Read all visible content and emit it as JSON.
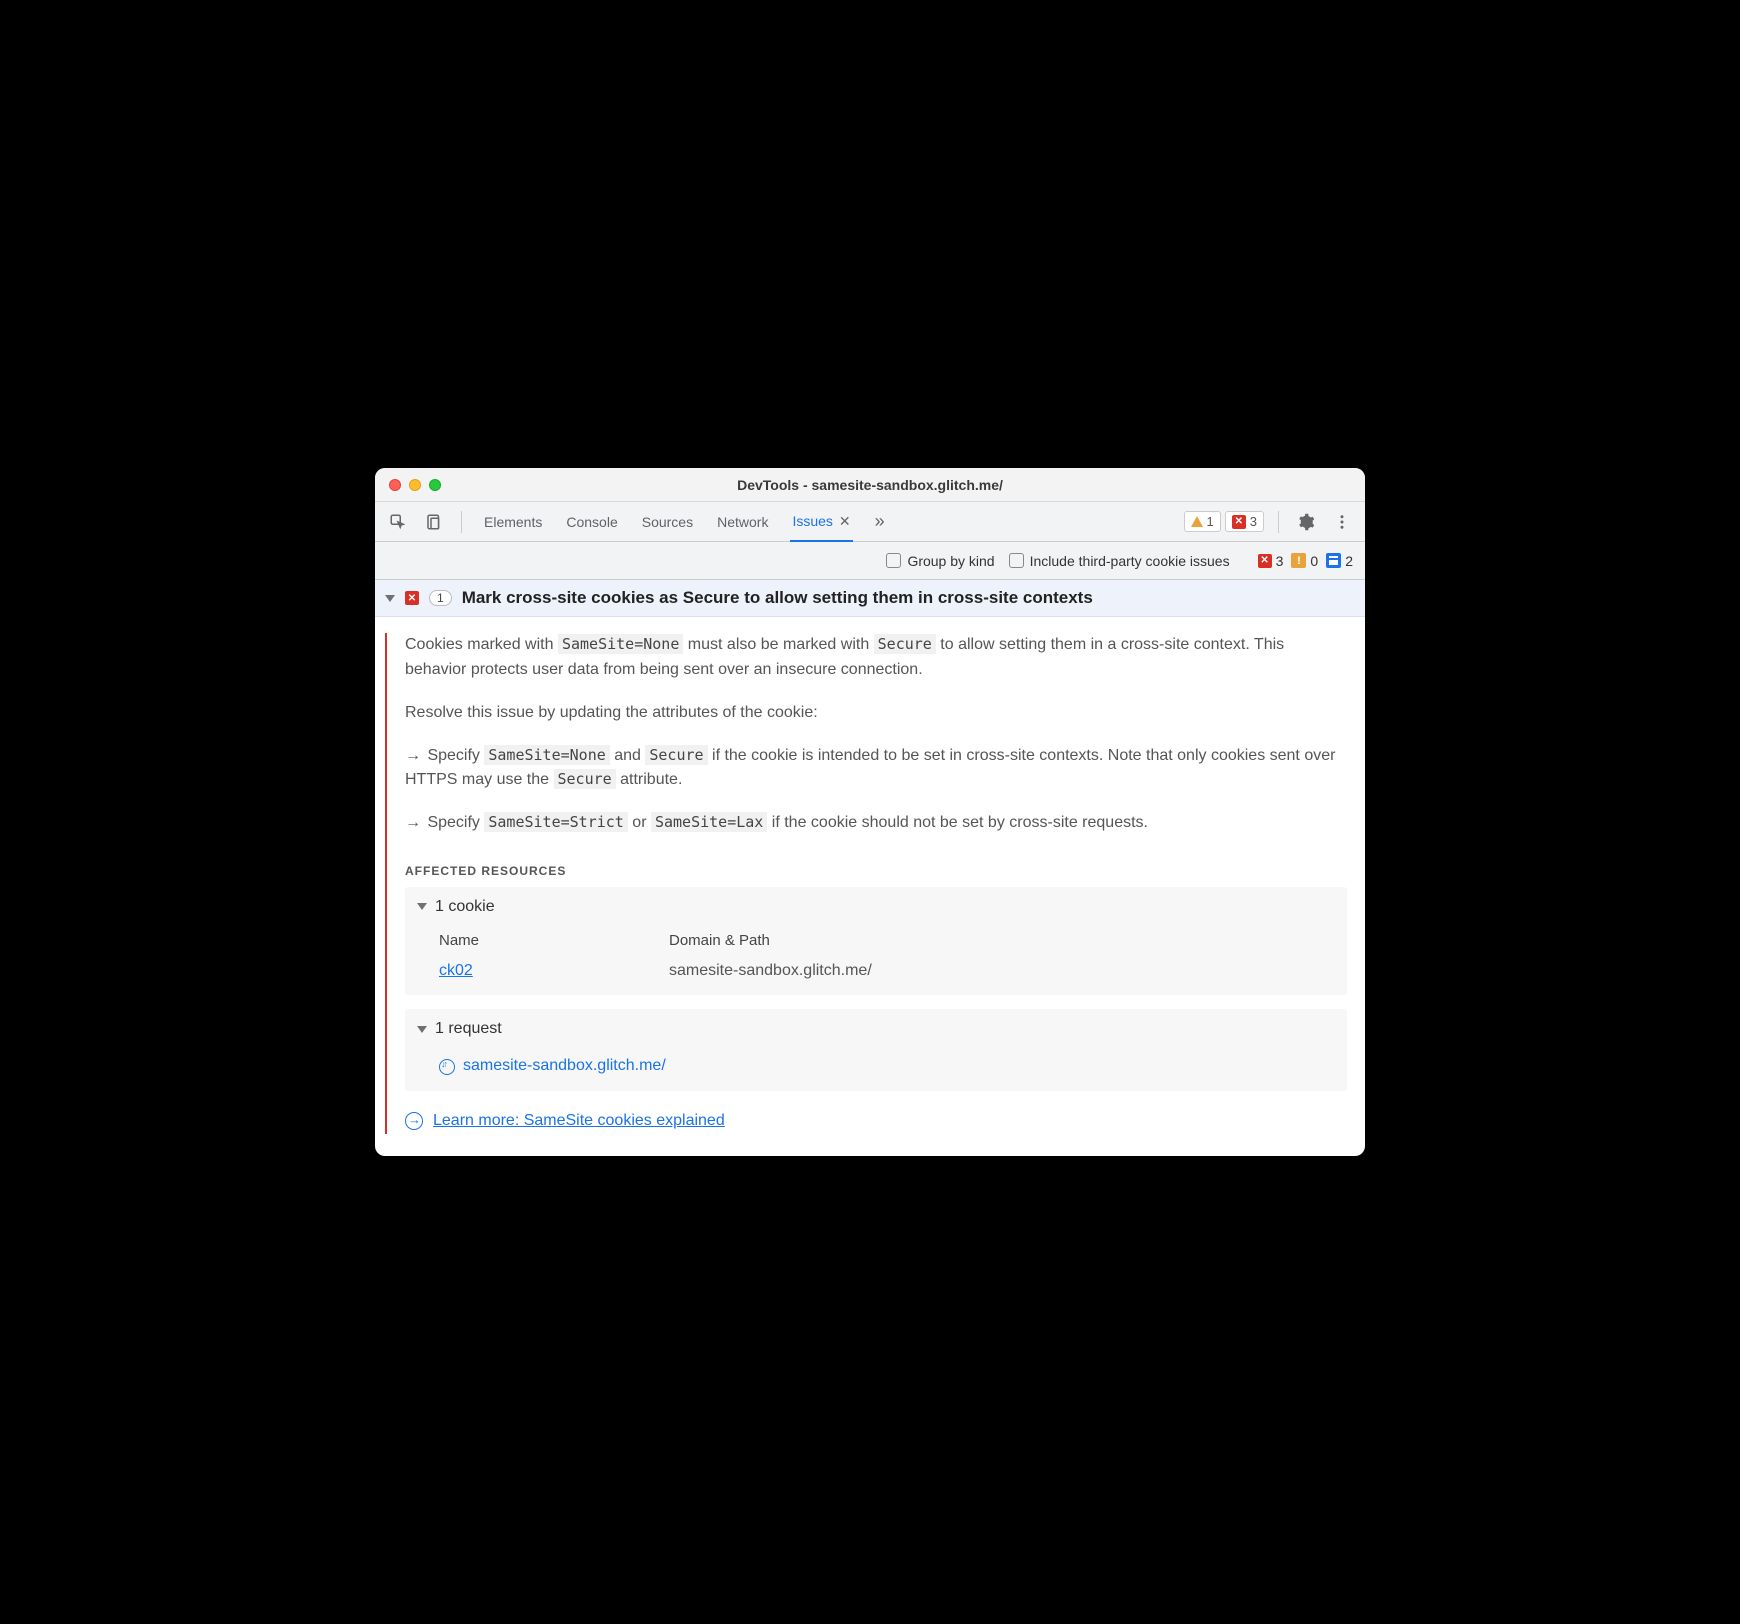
{
  "window": {
    "title": "DevTools - samesite-sandbox.glitch.me/"
  },
  "toolbar": {
    "tabs": {
      "elements": "Elements",
      "console": "Console",
      "sources": "Sources",
      "network": "Network",
      "issues": "Issues"
    },
    "warn_count": "1",
    "err_count": "3"
  },
  "filter": {
    "group_by_kind": "Group by kind",
    "include_third_party": "Include third-party cookie issues",
    "errors": "3",
    "warnings": "0",
    "info": "2"
  },
  "issue": {
    "count": "1",
    "title": "Mark cross-site cookies as Secure to allow setting them in cross-site contexts",
    "p1_a": "Cookies marked with ",
    "p1_code1": "SameSite=None",
    "p1_b": " must also be marked with ",
    "p1_code2": "Secure",
    "p1_c": " to allow setting them in a cross-site context. This behavior protects user data from being sent over an insecure connection.",
    "p2": "Resolve this issue by updating the attributes of the cookie:",
    "b1_a": "Specify ",
    "b1_code1": "SameSite=None",
    "b1_b": " and ",
    "b1_code2": "Secure",
    "b1_c": " if the cookie is intended to be set in cross-site contexts. Note that only cookies sent over HTTPS may use the ",
    "b1_code3": "Secure",
    "b1_d": " attribute.",
    "b2_a": "Specify ",
    "b2_code1": "SameSite=Strict",
    "b2_b": " or ",
    "b2_code2": "SameSite=Lax",
    "b2_c": " if the cookie should not be set by cross-site requests.",
    "affected_label": "AFFECTED RESOURCES",
    "cookie_head": "1 cookie",
    "cookie_col1": "Name",
    "cookie_col2": "Domain & Path",
    "cookie_name": "ck02",
    "cookie_domain": "samesite-sandbox.glitch.me/",
    "request_head": "1 request",
    "request_url": "samesite-sandbox.glitch.me/",
    "learn_more": "Learn more: SameSite cookies explained"
  }
}
